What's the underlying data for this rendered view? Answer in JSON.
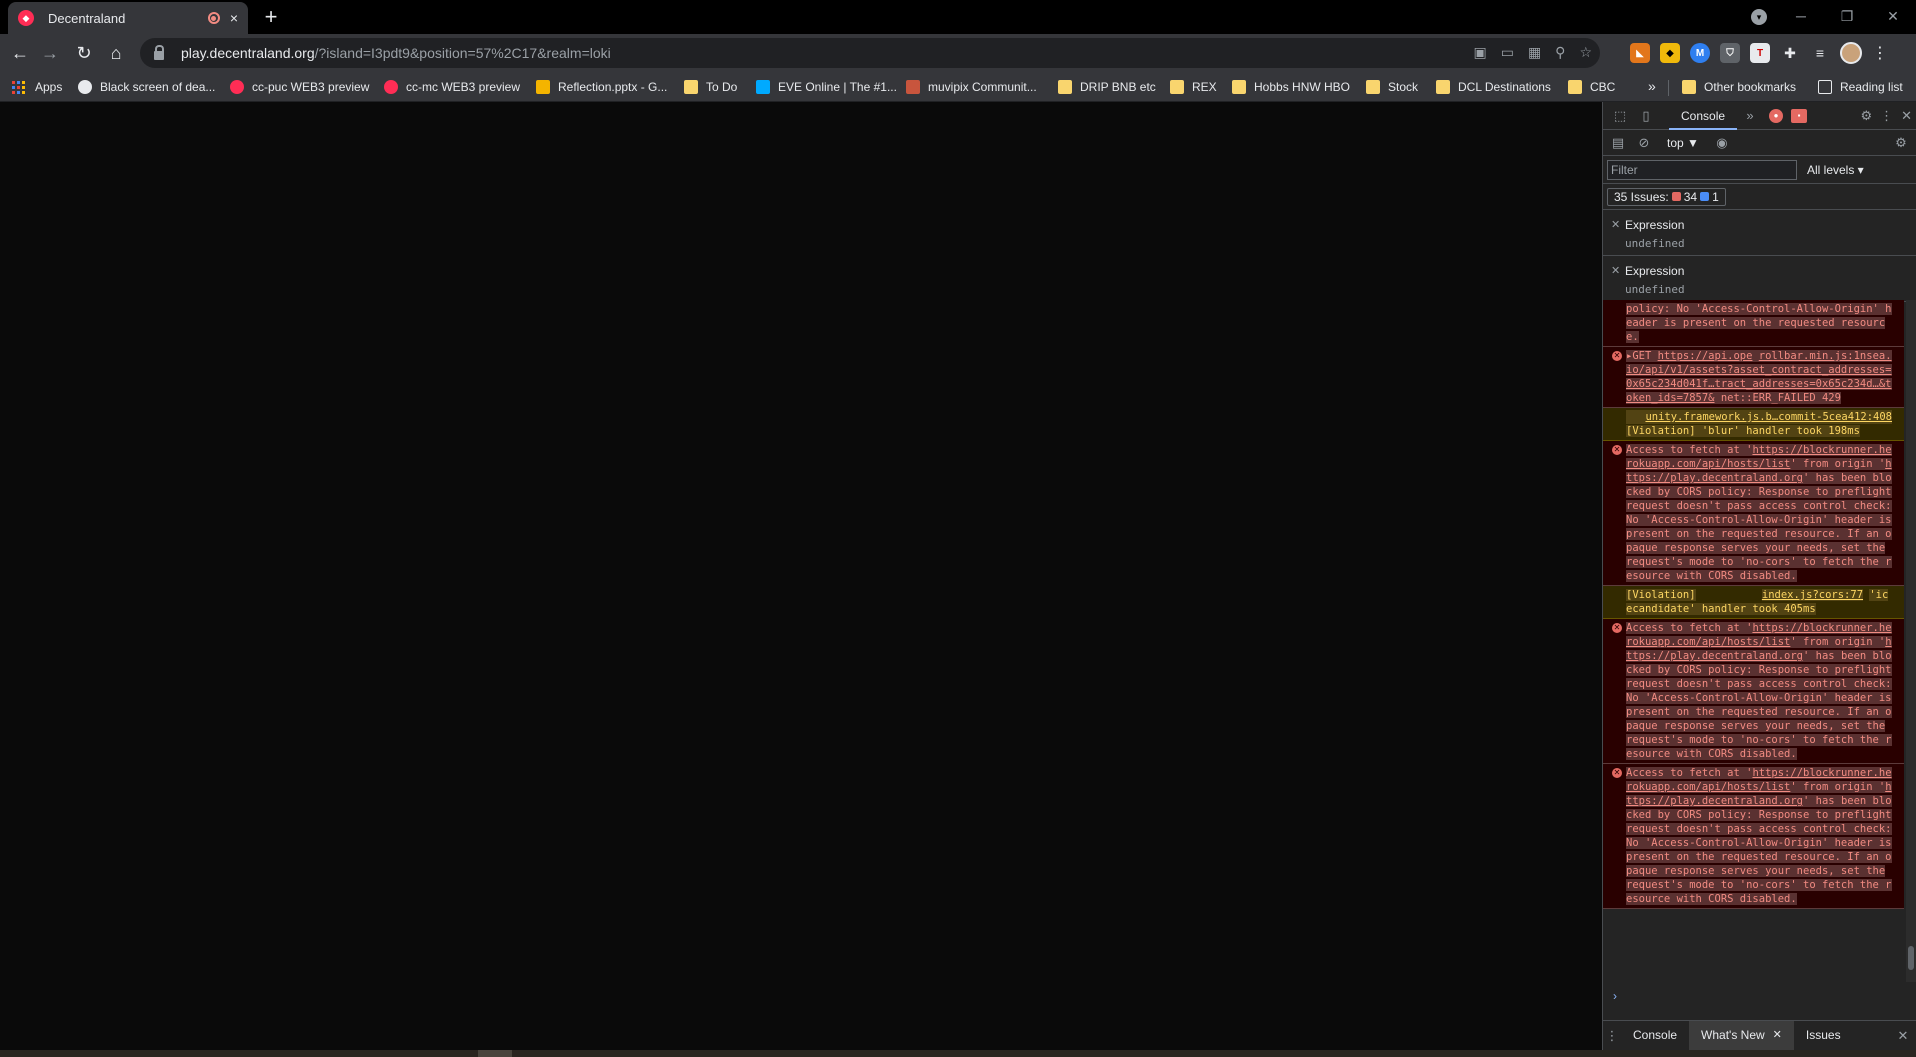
{
  "browser": {
    "tab_title": "Decentraland",
    "tab_close": "×",
    "new_tab": "+",
    "url_host": "play.decentraland.org",
    "url_rest": "/?island=I3pdt9&position=57%2C17&realm=loki"
  },
  "bookmarks": [
    {
      "label": "Apps",
      "icon": "apps-grid-icon"
    },
    {
      "label": "Black screen of dea...",
      "icon": "github-icon"
    },
    {
      "label": "cc-puc WEB3 preview",
      "icon": "decentraland-icon"
    },
    {
      "label": "cc-mc WEB3 preview",
      "icon": "decentraland-icon"
    },
    {
      "label": "Reflection.pptx - G...",
      "icon": "slides-icon"
    },
    {
      "label": "To Do",
      "icon": "folder-icon"
    },
    {
      "label": "EVE Online | The #1...",
      "icon": "eve-icon"
    },
    {
      "label": "muvipix Communit...",
      "icon": "muvipix-icon"
    },
    {
      "label": "DRIP BNB etc",
      "icon": "folder-icon"
    },
    {
      "label": "REX",
      "icon": "folder-icon"
    },
    {
      "label": "Hobbs HNW HBO",
      "icon": "folder-icon"
    },
    {
      "label": "Stock",
      "icon": "folder-icon"
    },
    {
      "label": "DCL Destinations",
      "icon": "folder-icon"
    },
    {
      "label": "CBC",
      "icon": "folder-icon"
    }
  ],
  "bookmarks_overflow": "»",
  "other_bookmarks": "Other bookmarks",
  "reading_list": "Reading list",
  "devtools": {
    "tab_console": "Console",
    "more_tabs": "»",
    "context": "top ▼",
    "filter_placeholder": "Filter",
    "levels": "All levels ▾",
    "issues_label": "35 Issues:",
    "issues_errors": "34",
    "issues_info": "1",
    "expressions": [
      {
        "title": "Expression",
        "value": "undefined"
      },
      {
        "title": "Expression",
        "value": "undefined"
      }
    ],
    "messages": {
      "m0": {
        "text": "policy: No 'Access-Control-Allow-Origin' header is present on the requested resource."
      },
      "m1": {
        "prefix": "▸GET ",
        "link": "https://api.ope",
        "source": "rollbar.min.js:1",
        "link2": "nsea.io/api/v1/assets?asset_contract_addresses=0x65c234d041f…tract_addresses=0x65c234d…&token_ids=7857&",
        "status": "net::ERR_FAILED 429"
      },
      "m2": {
        "source": "unity.framework.js.b…commit-5cea412:408",
        "text": "[Violation] 'blur' handler took 198ms"
      },
      "m3": {
        "text_a": "Access to fetch at '",
        "link_a": "https://blockrunner.herokuapp.com/api/hosts/list",
        "text_b": "' from origin '",
        "link_b": "https://play.decentraland.org",
        "text_c": "' has been blocked by CORS policy: Response to preflight request doesn't pass access control check: No 'Access-Control-Allow-Origin' header is present on the requested resource. If an opaque response serves your needs, set the request's mode to 'no-cors' to fetch the resource with CORS disabled."
      },
      "m4": {
        "text": "[Violation]",
        "source": "index.js?cors:77",
        "text2": "'icecandidate' handler took 405ms"
      },
      "m5": {
        "text_a": "Access to fetch at '",
        "link_a": "https://blockrunner.herokuapp.com/api/hosts/list",
        "text_b": "' from origin '",
        "link_b": "https://play.decentraland.org",
        "text_c": "' has been blocked by CORS policy: Response to preflight request doesn't pass access control check: No 'Access-Control-Allow-Origin' header is present on the requested resource. If an opaque response serves your needs, set the request's mode to 'no-cors' to fetch the resource with CORS disabled."
      },
      "m6": {
        "text_a": "Access to fetch at '",
        "link_a": "https://blockrunner.herokuapp.com/api/hosts/list",
        "text_b": "' from origin '",
        "link_b": "https://play.decentraland.org",
        "text_c": "' has been blocked by CORS policy: Response to preflight request doesn't pass access control check: No 'Access-Control-Allow-Origin' header is present on the requested resource. If an opaque response serves your needs, set the request's mode to 'no-cors' to fetch the resource with CORS disabled."
      }
    },
    "prompt": "›",
    "drawer": {
      "console": "Console",
      "whats_new": "What's New",
      "issues": "Issues",
      "close": "✕"
    }
  },
  "colors": {
    "error_text": "#f28b82",
    "warning_text": "#fdd663",
    "accent": "#8ab4f8"
  }
}
